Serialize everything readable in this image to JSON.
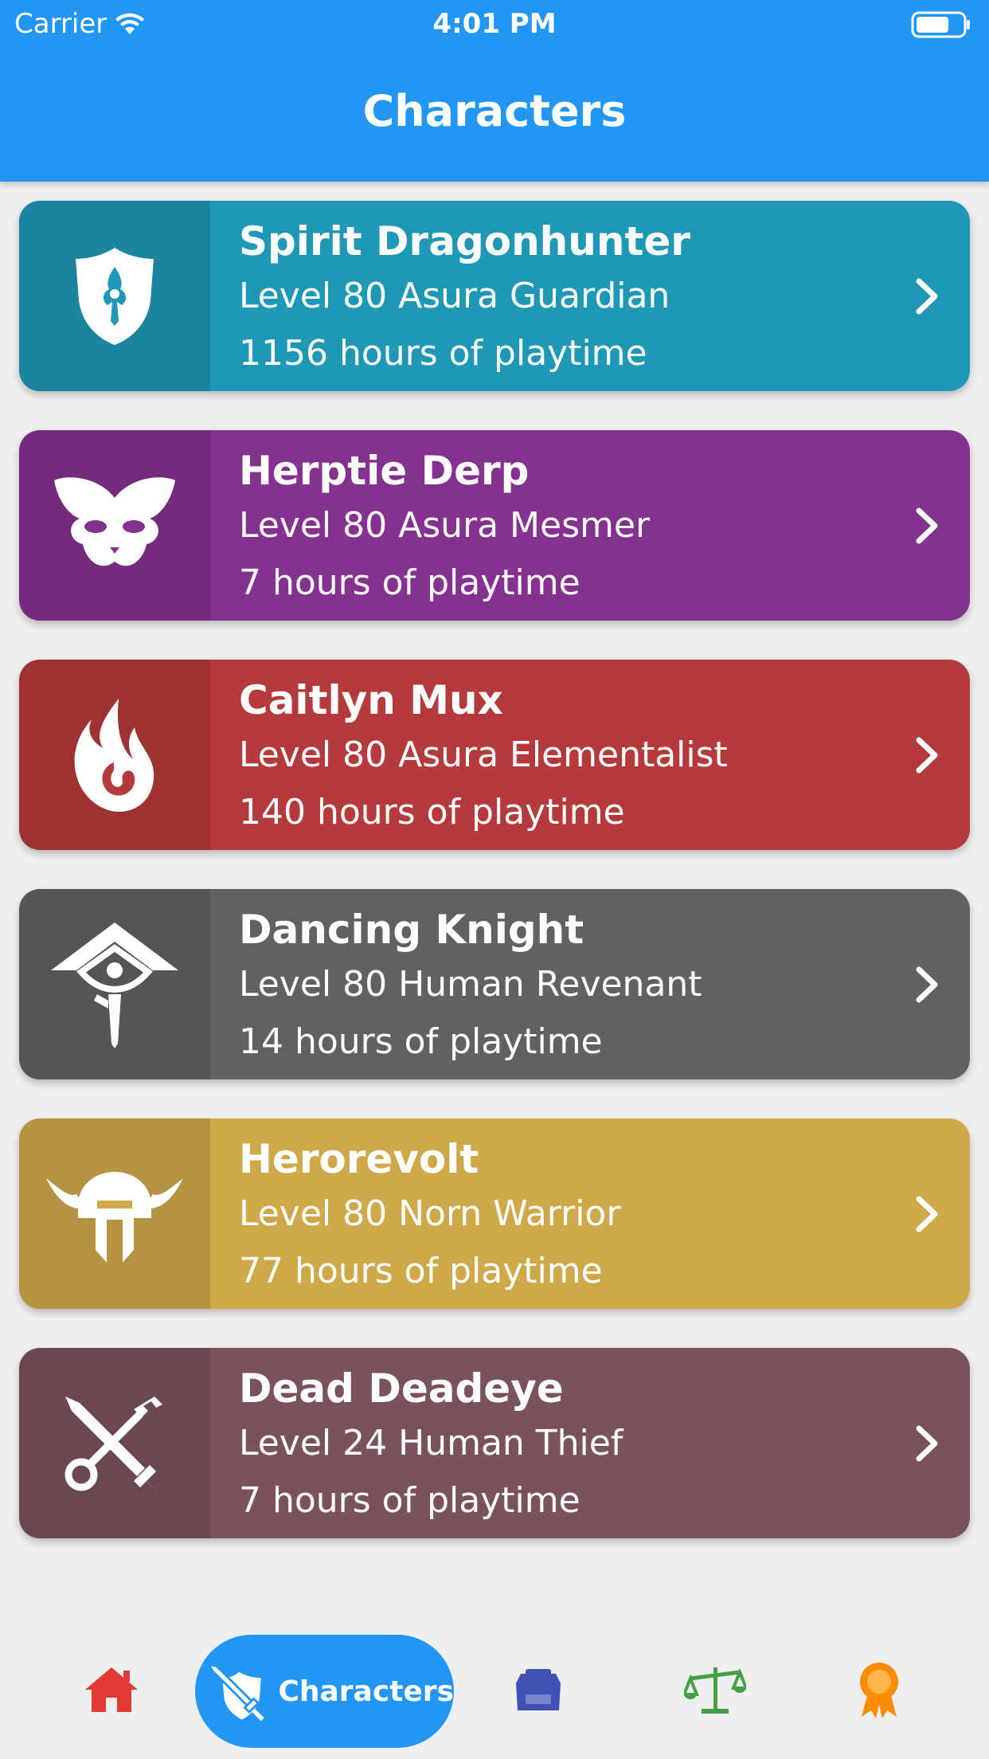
{
  "status_bar": {
    "carrier": "Carrier",
    "time": "4:01 PM"
  },
  "header": {
    "title": "Characters"
  },
  "characters": [
    {
      "name": "Spirit Dragonhunter",
      "level_line": "Level 80 Asura Guardian",
      "playtime": "1156 hours of playtime",
      "color": "#1f98b5",
      "icon": "guardian-shield-icon"
    },
    {
      "name": "Herptie Derp",
      "level_line": "Level 80 Asura Mesmer",
      "playtime": "7 hours of playtime",
      "color": "#85318f",
      "icon": "mesmer-mask-icon"
    },
    {
      "name": "Caitlyn Mux",
      "level_line": "Level 80 Asura Elementalist",
      "playtime": "140 hours of playtime",
      "color": "#b43a3b",
      "icon": "elementalist-flame-icon"
    },
    {
      "name": "Dancing Knight",
      "level_line": "Level 80 Human Revenant",
      "playtime": "14 hours of playtime",
      "color": "#616161",
      "icon": "revenant-sigil-icon"
    },
    {
      "name": "Herorevolt",
      "level_line": "Level 80 Norn Warrior",
      "playtime": "77 hours of playtime",
      "color": "#cfa84a",
      "icon": "warrior-helm-icon"
    },
    {
      "name": "Dead Deadeye",
      "level_line": "Level 24 Human Thief",
      "playtime": "7 hours of playtime",
      "color": "#7a535a",
      "icon": "thief-dagger-key-icon"
    }
  ],
  "bottom_nav": {
    "active_label": "Characters",
    "tabs": [
      {
        "name": "home",
        "icon": "home-icon",
        "color": "#e53935"
      },
      {
        "name": "characters",
        "icon": "sword-shield-icon",
        "color": "#ffffff"
      },
      {
        "name": "bank",
        "icon": "bag-icon",
        "color": "#3f51b5"
      },
      {
        "name": "trading",
        "icon": "scales-icon",
        "color": "#43a047"
      },
      {
        "name": "achievements",
        "icon": "award-icon",
        "color": "#fb8c00"
      }
    ]
  }
}
